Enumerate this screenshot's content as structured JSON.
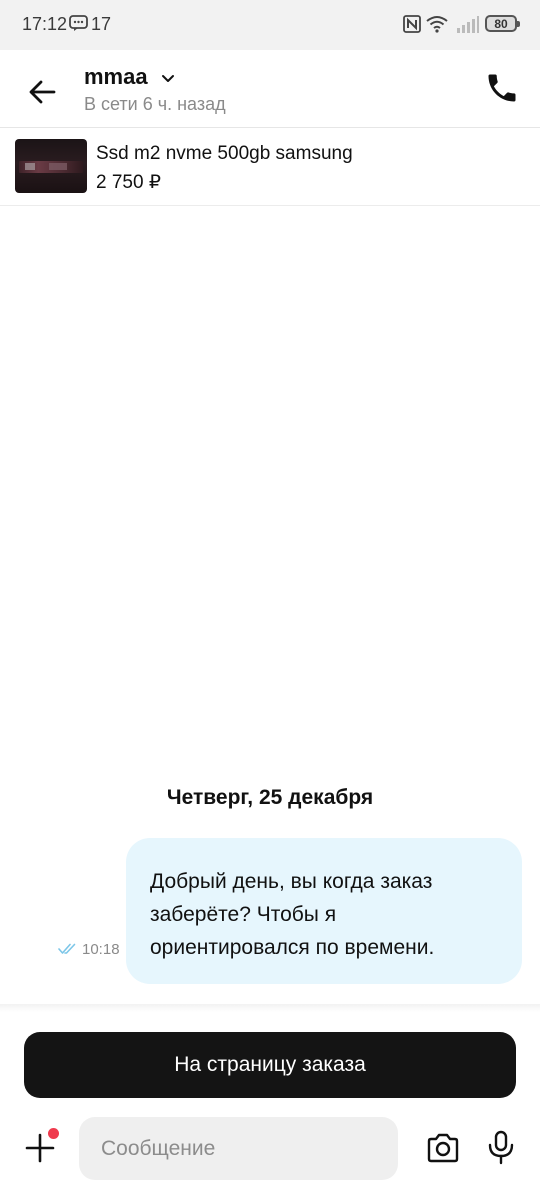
{
  "status_bar": {
    "time": "17:12",
    "notification_count": "17",
    "battery": "80",
    "icons": [
      "message-icon",
      "nfc-icon",
      "wifi-icon",
      "signal-icon",
      "battery-icon"
    ]
  },
  "header": {
    "contact_name": "mmaa",
    "contact_status": "В сети 6 ч. назад",
    "icons": [
      "back-arrow-icon",
      "chevron-down-icon",
      "phone-icon"
    ]
  },
  "product": {
    "title": "Ssd m2 nvme 500gb samsung",
    "price": "2 750 ₽"
  },
  "chat": {
    "date_separator": "Четверг, 25 декабря",
    "messages": [
      {
        "text": "Добрый день, вы когда заказ заберёте? Чтобы я ориентировался по времени.",
        "time": "10:18",
        "status": "read",
        "direction": "outgoing"
      }
    ]
  },
  "order_button": {
    "label": "На страницу заказа"
  },
  "composer": {
    "placeholder": "Сообщение",
    "value": "",
    "icons": [
      "plus-icon",
      "camera-icon",
      "microphone-icon"
    ]
  },
  "colors": {
    "bubble_bg": "#e6f6fd",
    "button_bg": "#141414",
    "badge_dot": "#ef3a4d",
    "read_ticks": "#7cc6e8",
    "secondary_text": "#8a8a8a"
  }
}
